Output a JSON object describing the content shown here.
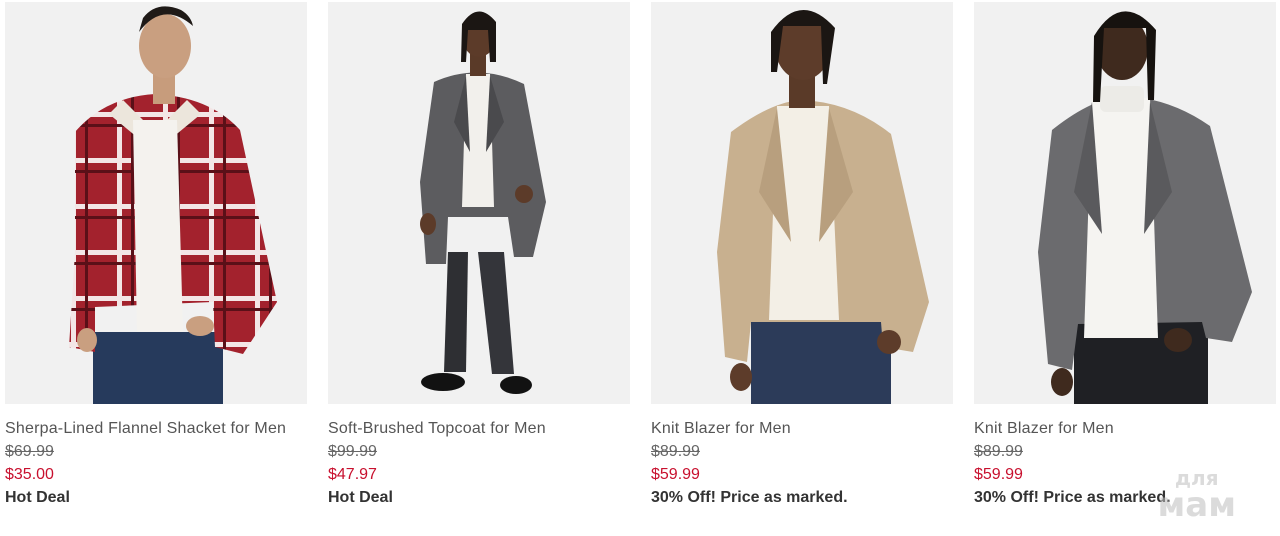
{
  "products": [
    {
      "title": "Sherpa-Lined Flannel Shacket for Men",
      "original_price": "$69.99",
      "sale_price": "$35.00",
      "promo": "Hot Deal",
      "garment_color": "#a3222d"
    },
    {
      "title": "Soft-Brushed Topcoat for Men",
      "original_price": "$99.99",
      "sale_price": "$47.97",
      "promo": "Hot Deal",
      "garment_color": "#5c5c5f"
    },
    {
      "title": "Knit Blazer for Men",
      "original_price": "$89.99",
      "sale_price": "$59.99",
      "promo": "30% Off! Price as marked.",
      "garment_color": "#c8b08f"
    },
    {
      "title": "Knit Blazer for Men",
      "original_price": "$89.99",
      "sale_price": "$59.99",
      "promo": "30% Off! Price as marked.",
      "garment_color": "#6b6b6e"
    }
  ],
  "colors": {
    "sale": "#c8102e",
    "title": "#555555",
    "promo": "#333333"
  },
  "watermark": {
    "line1": "для",
    "line2": "мам"
  }
}
